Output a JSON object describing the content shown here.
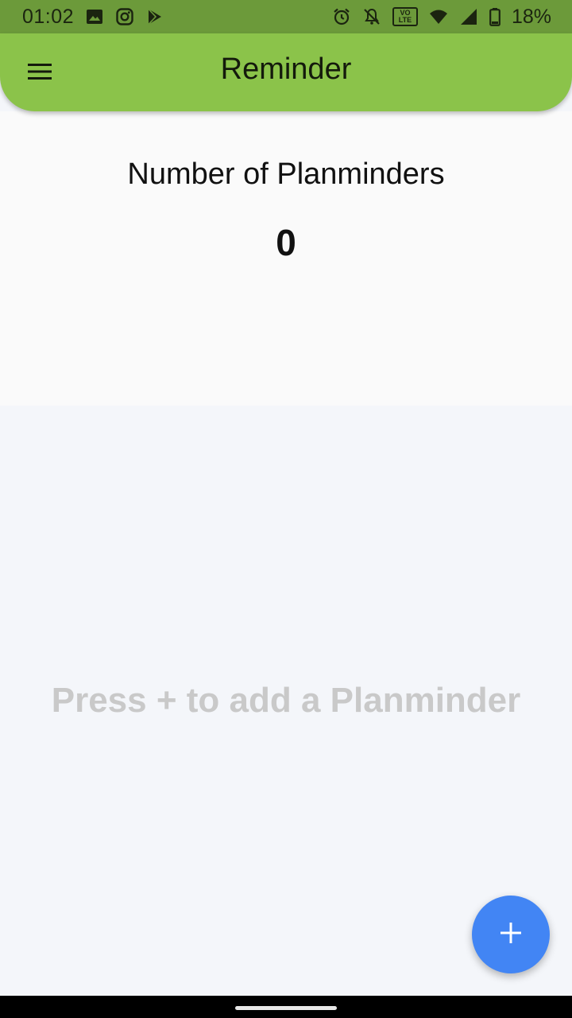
{
  "status_bar": {
    "time": "01:02",
    "battery": "18%",
    "network_badge_top": "VO",
    "network_badge_bottom": "LTE",
    "left_icons": [
      "gallery-icon",
      "instagram-icon",
      "play-store-icon"
    ],
    "right_icons": [
      "alarm-icon",
      "notifications-off-icon",
      "volte-icon",
      "wifi-icon",
      "signal-icon",
      "battery-icon"
    ]
  },
  "app_bar": {
    "title": "Reminder",
    "menu_icon": "menu-icon",
    "color": "#8bc34a"
  },
  "summary": {
    "label": "Number of Planminders",
    "count": "0"
  },
  "empty_state": {
    "hint": "Press + to add a Planminder"
  },
  "fab": {
    "icon": "add-icon",
    "color": "#4285f4"
  },
  "colors": {
    "status_bar": "#6c9a3a",
    "background": "#f4f6fa",
    "hint_text": "#c9c9c9"
  }
}
